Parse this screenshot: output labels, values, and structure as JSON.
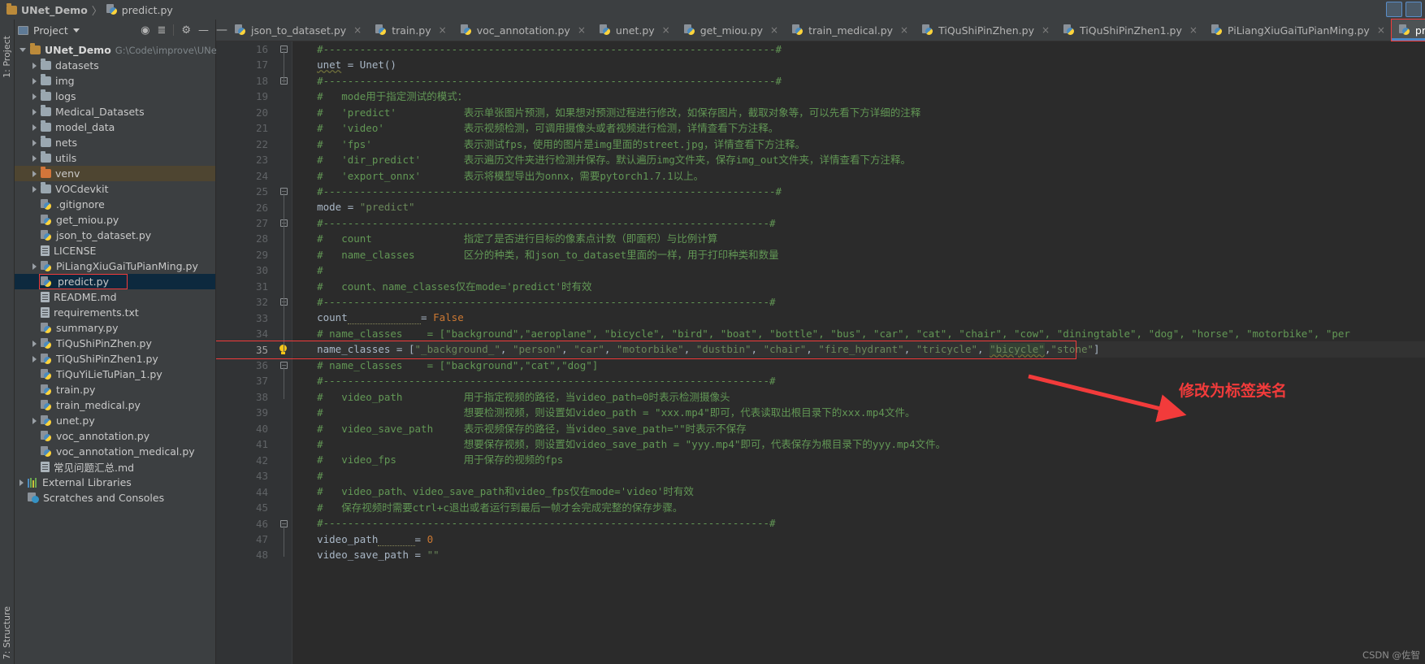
{
  "window": {
    "breadcrumb": [
      "UNet_Demo",
      "predict.py"
    ],
    "breadcrumb_sep": "〉"
  },
  "left_strips": {
    "project_label": "1: Project",
    "structure_label": "7: Structure"
  },
  "project_panel": {
    "title": "Project",
    "actions": [
      "target-icon",
      "collapse-all-icon",
      "gear-icon",
      "hide-icon"
    ],
    "tree": [
      {
        "indent": 0,
        "arrow": "open",
        "icon": "folder-mod",
        "label": "UNet_Demo",
        "path": "G:\\Code\\improve\\UNet_Demo",
        "state": "root"
      },
      {
        "indent": 1,
        "arrow": "closed",
        "icon": "folder",
        "label": "datasets",
        "path": "",
        "state": ""
      },
      {
        "indent": 1,
        "arrow": "closed",
        "icon": "folder",
        "label": "img",
        "path": "",
        "state": ""
      },
      {
        "indent": 1,
        "arrow": "closed",
        "icon": "folder",
        "label": "logs",
        "path": "",
        "state": ""
      },
      {
        "indent": 1,
        "arrow": "closed",
        "icon": "folder",
        "label": "Medical_Datasets",
        "path": "",
        "state": ""
      },
      {
        "indent": 1,
        "arrow": "closed",
        "icon": "folder",
        "label": "model_data",
        "path": "",
        "state": ""
      },
      {
        "indent": 1,
        "arrow": "closed",
        "icon": "folder",
        "label": "nets",
        "path": "",
        "state": ""
      },
      {
        "indent": 1,
        "arrow": "closed",
        "icon": "folder",
        "label": "utils",
        "path": "",
        "state": ""
      },
      {
        "indent": 1,
        "arrow": "closed",
        "icon": "folder-orange",
        "label": "venv",
        "path": "",
        "state": "highlight"
      },
      {
        "indent": 1,
        "arrow": "closed",
        "icon": "folder",
        "label": "VOCdevkit",
        "path": "",
        "state": ""
      },
      {
        "indent": 1,
        "arrow": "none",
        "icon": "py-ignored",
        "label": ".gitignore",
        "path": "",
        "state": ""
      },
      {
        "indent": 1,
        "arrow": "none",
        "icon": "py",
        "label": "get_miou.py",
        "path": "",
        "state": ""
      },
      {
        "indent": 1,
        "arrow": "none",
        "icon": "py",
        "label": "json_to_dataset.py",
        "path": "",
        "state": ""
      },
      {
        "indent": 1,
        "arrow": "none",
        "icon": "doc",
        "label": "LICENSE",
        "path": "",
        "state": ""
      },
      {
        "indent": 1,
        "arrow": "closed",
        "icon": "py",
        "label": "PiLiangXiuGaiTuPianMing.py",
        "path": "",
        "state": ""
      },
      {
        "indent": 1,
        "arrow": "none",
        "icon": "py",
        "label": "predict.py",
        "path": "",
        "state": "selected-boxed"
      },
      {
        "indent": 1,
        "arrow": "none",
        "icon": "doc",
        "label": "README.md",
        "path": "",
        "state": ""
      },
      {
        "indent": 1,
        "arrow": "none",
        "icon": "doc",
        "label": "requirements.txt",
        "path": "",
        "state": ""
      },
      {
        "indent": 1,
        "arrow": "none",
        "icon": "py",
        "label": "summary.py",
        "path": "",
        "state": ""
      },
      {
        "indent": 1,
        "arrow": "closed",
        "icon": "py",
        "label": "TiQuShiPinZhen.py",
        "path": "",
        "state": ""
      },
      {
        "indent": 1,
        "arrow": "closed",
        "icon": "py",
        "label": "TiQuShiPinZhen1.py",
        "path": "",
        "state": ""
      },
      {
        "indent": 1,
        "arrow": "none",
        "icon": "py",
        "label": "TiQuYiLieTuPian_1.py",
        "path": "",
        "state": ""
      },
      {
        "indent": 1,
        "arrow": "none",
        "icon": "py",
        "label": "train.py",
        "path": "",
        "state": ""
      },
      {
        "indent": 1,
        "arrow": "none",
        "icon": "py",
        "label": "train_medical.py",
        "path": "",
        "state": ""
      },
      {
        "indent": 1,
        "arrow": "closed",
        "icon": "py",
        "label": "unet.py",
        "path": "",
        "state": ""
      },
      {
        "indent": 1,
        "arrow": "none",
        "icon": "py",
        "label": "voc_annotation.py",
        "path": "",
        "state": ""
      },
      {
        "indent": 1,
        "arrow": "none",
        "icon": "py",
        "label": "voc_annotation_medical.py",
        "path": "",
        "state": ""
      },
      {
        "indent": 1,
        "arrow": "none",
        "icon": "doc",
        "label": "常见问题汇总.md",
        "path": "",
        "state": ""
      },
      {
        "indent": 0,
        "arrow": "closed",
        "icon": "lib",
        "label": "External Libraries",
        "path": "",
        "state": ""
      },
      {
        "indent": 0,
        "arrow": "none",
        "icon": "scratch",
        "label": "Scratches and Consoles",
        "path": "",
        "state": ""
      }
    ]
  },
  "editor_tabs": {
    "collapse_glyph": "—",
    "tabs": [
      {
        "label": "json_to_dataset.py",
        "active": false
      },
      {
        "label": "train.py",
        "active": false
      },
      {
        "label": "voc_annotation.py",
        "active": false
      },
      {
        "label": "unet.py",
        "active": false
      },
      {
        "label": "get_miou.py",
        "active": false
      },
      {
        "label": "train_medical.py",
        "active": false
      },
      {
        "label": "TiQuShiPinZhen.py",
        "active": false
      },
      {
        "label": "TiQuShiPinZhen1.py",
        "active": false
      },
      {
        "label": "PiLiangXiuGaiTuPianMing.py",
        "active": false
      },
      {
        "label": "predict.py",
        "active": true
      }
    ],
    "close_glyph": "×"
  },
  "editor": {
    "first_line_number": 16,
    "active_line_number": 35,
    "lines": [
      {
        "n": 16,
        "fold": "minus",
        "segs": [
          {
            "t": "    #--------------------------------------------------------------------------#",
            "c": "c"
          }
        ]
      },
      {
        "n": 17,
        "fold": "",
        "segs": [
          {
            "t": "    ",
            "c": "id"
          },
          {
            "t": "unet",
            "c": "id err-ul"
          },
          {
            "t": " = Unet()",
            "c": "id"
          }
        ]
      },
      {
        "n": 18,
        "fold": "minus",
        "segs": [
          {
            "t": "    #--------------------------------------------------------------------------#",
            "c": "c"
          }
        ]
      },
      {
        "n": 19,
        "fold": "",
        "segs": [
          {
            "t": "    #   mode用于指定测试的模式：",
            "c": "c"
          }
        ]
      },
      {
        "n": 20,
        "fold": "",
        "segs": [
          {
            "t": "    #   'predict'           表示单张图片预测，如果想对预测过程进行修改，如保存图片，截取对象等，可以先看下方详细的注释",
            "c": "c"
          }
        ]
      },
      {
        "n": 21,
        "fold": "",
        "segs": [
          {
            "t": "    #   'video'             表示视频检测，可调用摄像头或者视频进行检测，详情查看下方注释。",
            "c": "c"
          }
        ]
      },
      {
        "n": 22,
        "fold": "",
        "segs": [
          {
            "t": "    #   'fps'               表示测试fps，使用的图片是img里面的street.jpg，详情查看下方注释。",
            "c": "c"
          }
        ]
      },
      {
        "n": 23,
        "fold": "",
        "segs": [
          {
            "t": "    #   'dir_predict'       表示遍历文件夹进行检测并保存。默认遍历img文件夹，保存img_out文件夹，详情查看下方注释。",
            "c": "c"
          }
        ]
      },
      {
        "n": 24,
        "fold": "",
        "segs": [
          {
            "t": "    #   'export_onnx'       表示将模型导出为onnx，需要pytorch1.7.1以上。",
            "c": "c"
          }
        ]
      },
      {
        "n": 25,
        "fold": "minus",
        "segs": [
          {
            "t": "    #--------------------------------------------------------------------------#",
            "c": "c"
          }
        ]
      },
      {
        "n": 26,
        "fold": "",
        "segs": [
          {
            "t": "    mode = ",
            "c": "id"
          },
          {
            "t": "\"predict\"",
            "c": "st"
          }
        ]
      },
      {
        "n": 27,
        "fold": "minus",
        "segs": [
          {
            "t": "    #-------------------------------------------------------------------------#",
            "c": "c"
          }
        ]
      },
      {
        "n": 28,
        "fold": "",
        "segs": [
          {
            "t": "    #   count               指定了是否进行目标的像素点计数（即面积）与比例计算",
            "c": "c"
          }
        ]
      },
      {
        "n": 29,
        "fold": "",
        "segs": [
          {
            "t": "    #   name_classes        区分的种类，和json_to_dataset里面的一样，用于打印种类和数量",
            "c": "c"
          }
        ]
      },
      {
        "n": 30,
        "fold": "",
        "segs": [
          {
            "t": "    #",
            "c": "c"
          }
        ]
      },
      {
        "n": 31,
        "fold": "",
        "segs": [
          {
            "t": "    #   count、name_classes仅在mode='predict'时有效",
            "c": "c"
          }
        ]
      },
      {
        "n": 32,
        "fold": "minus",
        "segs": [
          {
            "t": "    #-------------------------------------------------------------------------#",
            "c": "c"
          }
        ]
      },
      {
        "n": 33,
        "fold": "",
        "segs": [
          {
            "t": "    count",
            "c": "id"
          },
          {
            "t": "            ",
            "c": "id warn-ul"
          },
          {
            "t": "= ",
            "c": "id"
          },
          {
            "t": "False",
            "c": "kw"
          }
        ]
      },
      {
        "n": 34,
        "fold": "",
        "segs": [
          {
            "t": "    # name_classes    = [\"background\",\"aeroplane\", \"bicycle\", \"bird\", \"boat\", \"bottle\", \"bus\", \"car\", \"cat\", \"chair\", \"cow\", \"diningtable\", \"dog\", \"horse\", \"motorbike\", \"per",
            "c": "c"
          }
        ]
      },
      {
        "n": 35,
        "fold": "",
        "segs": [
          {
            "t": "    name_classes = [",
            "c": "id"
          },
          {
            "t": "\"_background_\"",
            "c": "st"
          },
          {
            "t": ", ",
            "c": "id"
          },
          {
            "t": "\"person\"",
            "c": "st"
          },
          {
            "t": ", ",
            "c": "id"
          },
          {
            "t": "\"car\"",
            "c": "st"
          },
          {
            "t": ", ",
            "c": "id"
          },
          {
            "t": "\"motorbike\"",
            "c": "st"
          },
          {
            "t": ", ",
            "c": "id"
          },
          {
            "t": "\"dustbin\"",
            "c": "st"
          },
          {
            "t": ", ",
            "c": "id"
          },
          {
            "t": "\"chair\"",
            "c": "st"
          },
          {
            "t": ", ",
            "c": "id"
          },
          {
            "t": "\"fire_hydrant\"",
            "c": "st"
          },
          {
            "t": ", ",
            "c": "id"
          },
          {
            "t": "\"tricycle\"",
            "c": "st"
          },
          {
            "t": ", ",
            "c": "id"
          },
          {
            "t": "\"bicycle\"",
            "c": "st sel-word err-ul"
          },
          {
            "t": ",",
            "c": "id"
          },
          {
            "t": "\"stone\"",
            "c": "st"
          },
          {
            "t": "]",
            "c": "id"
          }
        ]
      },
      {
        "n": 36,
        "fold": "minus",
        "segs": [
          {
            "t": "    # name_classes    = [\"background\",\"cat\",\"dog\"]",
            "c": "c"
          }
        ]
      },
      {
        "n": 37,
        "fold": "",
        "segs": [
          {
            "t": "    #-------------------------------------------------------------------------#",
            "c": "c"
          }
        ]
      },
      {
        "n": 38,
        "fold": "",
        "segs": [
          {
            "t": "    #   video_path          用于指定视频的路径，当video_path=0时表示检测摄像头",
            "c": "c"
          }
        ]
      },
      {
        "n": 39,
        "fold": "",
        "segs": [
          {
            "t": "    #                       想要检测视频，则设置如video_path = \"xxx.mp4\"即可，代表读取出根目录下的xxx.mp4文件。",
            "c": "c"
          }
        ]
      },
      {
        "n": 40,
        "fold": "",
        "segs": [
          {
            "t": "    #   video_save_path     表示视频保存的路径，当video_save_path=\"\"时表示不保存",
            "c": "c"
          }
        ]
      },
      {
        "n": 41,
        "fold": "",
        "segs": [
          {
            "t": "    #                       想要保存视频，则设置如video_save_path = \"yyy.mp4\"即可，代表保存为根目录下的yyy.mp4文件。",
            "c": "c"
          }
        ]
      },
      {
        "n": 42,
        "fold": "",
        "segs": [
          {
            "t": "    #   video_fps           用于保存的视频的fps",
            "c": "c"
          }
        ]
      },
      {
        "n": 43,
        "fold": "",
        "segs": [
          {
            "t": "    #",
            "c": "c"
          }
        ]
      },
      {
        "n": 44,
        "fold": "",
        "segs": [
          {
            "t": "    #   video_path、video_save_path和video_fps仅在mode='video'时有效",
            "c": "c"
          }
        ]
      },
      {
        "n": 45,
        "fold": "",
        "segs": [
          {
            "t": "    #   保存视频时需要ctrl+c退出或者运行到最后一帧才会完成完整的保存步骤。",
            "c": "c"
          }
        ]
      },
      {
        "n": 46,
        "fold": "minus",
        "segs": [
          {
            "t": "    #-------------------------------------------------------------------------#",
            "c": "c"
          }
        ]
      },
      {
        "n": 47,
        "fold": "",
        "segs": [
          {
            "t": "    video_path",
            "c": "id"
          },
          {
            "t": "      ",
            "c": "id warn-ul"
          },
          {
            "t": "= ",
            "c": "id"
          },
          {
            "t": "0",
            "c": "kw"
          }
        ]
      },
      {
        "n": 48,
        "fold": "",
        "segs": [
          {
            "t": "    video_save_path = ",
            "c": "id"
          },
          {
            "t": "\"\"",
            "c": "st"
          }
        ]
      }
    ]
  },
  "annotations": {
    "note_text": "修改为标签类名",
    "note_color": "#f23b3b",
    "arrow_color": "#f23b3b"
  },
  "watermark": {
    "text": "CSDN @佐智"
  }
}
